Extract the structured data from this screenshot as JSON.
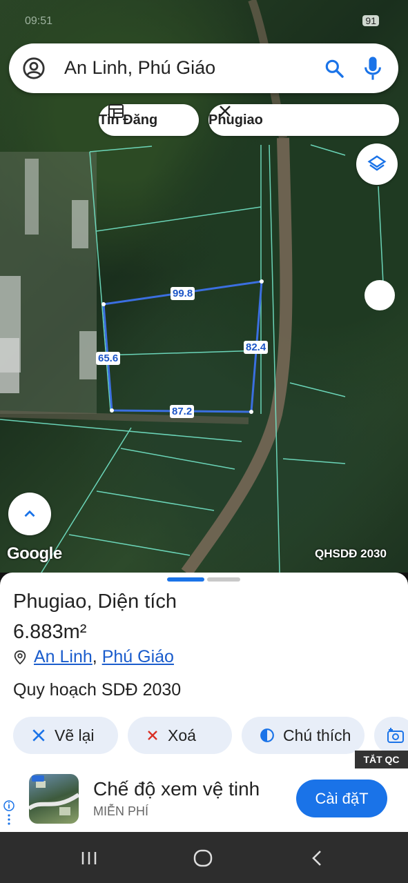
{
  "statusbar": {
    "time": "09:51",
    "battery": "91"
  },
  "search": {
    "query": "An Linh, Phú Giáo"
  },
  "chips": [
    {
      "label": "Tin Đăng"
    },
    {
      "label": "Phugiao"
    }
  ],
  "map": {
    "measurements": {
      "top": "99.8",
      "left": "65.6",
      "right": "82.4",
      "bottom": "87.2"
    },
    "attribution": "Google",
    "layer_label": "QHSDĐ 2030",
    "boundary_color": "#3b6fe0"
  },
  "sheet": {
    "title": "Phugiao",
    "title_suffix": ", Diện tích",
    "area": "6.883m²",
    "location_1": "An Linh",
    "location_sep": ", ",
    "location_2": "Phú Giáo",
    "plan": "Quy hoạch SDĐ 2030",
    "buttons": [
      {
        "label": "Vẽ lại"
      },
      {
        "label": "Xoá"
      },
      {
        "label": "Chú thích"
      }
    ]
  },
  "ad": {
    "close_label": "TẮT QC",
    "headline": "Chế độ xem vệ tinh",
    "sub": "MIỄN PHÍ",
    "cta": "Cài đặT"
  }
}
